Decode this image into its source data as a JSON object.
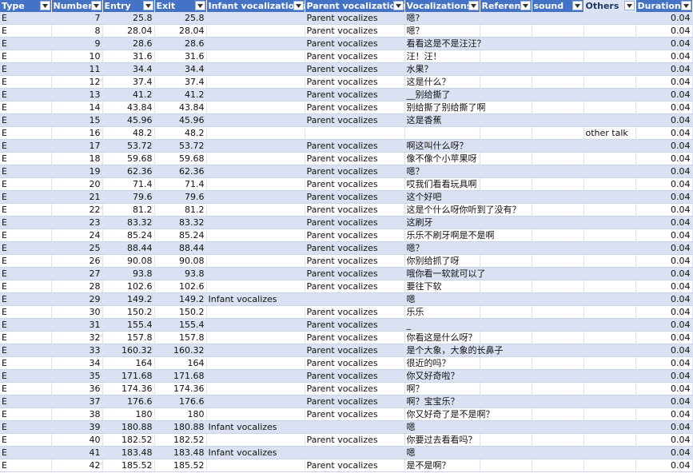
{
  "headers": [
    {
      "key": "type",
      "label": "Type"
    },
    {
      "key": "number",
      "label": "Number"
    },
    {
      "key": "entry",
      "label": "Entry"
    },
    {
      "key": "exit",
      "label": "Exit"
    },
    {
      "key": "infant",
      "label": "Infant vocalizations"
    },
    {
      "key": "parent",
      "label": "Parent vocalizations"
    },
    {
      "key": "vocalizations",
      "label": "Vocalizations"
    },
    {
      "key": "referent",
      "label": "Referent"
    },
    {
      "key": "sound",
      "label": "sound"
    },
    {
      "key": "others",
      "label": "Others"
    },
    {
      "key": "duration",
      "label": "Duration"
    }
  ],
  "rows": [
    {
      "type": "E",
      "number": "7",
      "entry": "25.8",
      "exit": "25.8",
      "infant": "",
      "parent": "Parent vocalizes",
      "vocalizations": "嗯?",
      "referent": "",
      "sound": "",
      "others": "",
      "duration": "0.04"
    },
    {
      "type": "E",
      "number": "8",
      "entry": "28.04",
      "exit": "28.04",
      "infant": "",
      "parent": "Parent vocalizes",
      "vocalizations": "嗯？",
      "referent": "",
      "sound": "",
      "others": "",
      "duration": "0.04"
    },
    {
      "type": "E",
      "number": "9",
      "entry": "28.6",
      "exit": "28.6",
      "infant": "",
      "parent": "Parent vocalizes",
      "vocalizations": "看看这是不是汪汪？",
      "referent": "",
      "sound": "",
      "others": "",
      "duration": "0.04"
    },
    {
      "type": "E",
      "number": "10",
      "entry": "31.6",
      "exit": "31.6",
      "infant": "",
      "parent": "Parent vocalizes",
      "vocalizations": "汪！汪！",
      "referent": "",
      "sound": "",
      "others": "",
      "duration": "0.04"
    },
    {
      "type": "E",
      "number": "11",
      "entry": "34.4",
      "exit": "34.4",
      "infant": "",
      "parent": "Parent vocalizes",
      "vocalizations": "水果？",
      "referent": "",
      "sound": "",
      "others": "",
      "duration": "0.04"
    },
    {
      "type": "E",
      "number": "12",
      "entry": "37.4",
      "exit": "37.4",
      "infant": "",
      "parent": "Parent vocalizes",
      "vocalizations": "这是什么？",
      "referent": "",
      "sound": "",
      "others": "",
      "duration": "0.04"
    },
    {
      "type": "E",
      "number": "13",
      "entry": "41.2",
      "exit": "41.2",
      "infant": "",
      "parent": "Parent vocalizes",
      "vocalizations": "__别给撕了",
      "referent": "",
      "sound": "",
      "others": "",
      "duration": "0.04"
    },
    {
      "type": "E",
      "number": "14",
      "entry": "43.84",
      "exit": "43.84",
      "infant": "",
      "parent": "Parent vocalizes",
      "vocalizations": "别给撕了别给撕了啊",
      "referent": "",
      "sound": "",
      "others": "",
      "duration": "0.04"
    },
    {
      "type": "E",
      "number": "15",
      "entry": "45.96",
      "exit": "45.96",
      "infant": "",
      "parent": "Parent vocalizes",
      "vocalizations": "这是香蕉",
      "referent": "",
      "sound": "",
      "others": "",
      "duration": "0.04"
    },
    {
      "type": "E",
      "number": "16",
      "entry": "48.2",
      "exit": "48.2",
      "infant": "",
      "parent": "",
      "vocalizations": "",
      "referent": "",
      "sound": "",
      "others": "other talk",
      "duration": "0.04"
    },
    {
      "type": "E",
      "number": "17",
      "entry": "53.72",
      "exit": "53.72",
      "infant": "",
      "parent": "Parent vocalizes",
      "vocalizations": "啊这叫什么呀？",
      "referent": "",
      "sound": "",
      "others": "",
      "duration": "0.04"
    },
    {
      "type": "E",
      "number": "18",
      "entry": "59.68",
      "exit": "59.68",
      "infant": "",
      "parent": "Parent vocalizes",
      "vocalizations": "像不像个小苹果呀",
      "referent": "",
      "sound": "",
      "others": "",
      "duration": "0.04"
    },
    {
      "type": "E",
      "number": "19",
      "entry": "62.36",
      "exit": "62.36",
      "infant": "",
      "parent": "Parent vocalizes",
      "vocalizations": "嗯？",
      "referent": "",
      "sound": "",
      "others": "",
      "duration": "0.04"
    },
    {
      "type": "E",
      "number": "20",
      "entry": "71.4",
      "exit": "71.4",
      "infant": "",
      "parent": "Parent vocalizes",
      "vocalizations": "哎我们看看玩具啊",
      "referent": "",
      "sound": "",
      "others": "",
      "duration": "0.04"
    },
    {
      "type": "E",
      "number": "21",
      "entry": "79.6",
      "exit": "79.6",
      "infant": "",
      "parent": "Parent vocalizes",
      "vocalizations": "这个好吧",
      "referent": "",
      "sound": "",
      "others": "",
      "duration": "0.04"
    },
    {
      "type": "E",
      "number": "22",
      "entry": "81.2",
      "exit": "81.2",
      "infant": "",
      "parent": "Parent vocalizes",
      "vocalizations": "这是个什么呀你听到了没有？",
      "referent": "",
      "sound": "",
      "others": "",
      "duration": "0.04"
    },
    {
      "type": "E",
      "number": "23",
      "entry": "83.32",
      "exit": "83.32",
      "infant": "",
      "parent": "Parent vocalizes",
      "vocalizations": "这刷牙",
      "referent": "",
      "sound": "",
      "others": "",
      "duration": "0.04"
    },
    {
      "type": "E",
      "number": "24",
      "entry": "85.24",
      "exit": "85.24",
      "infant": "",
      "parent": "Parent vocalizes",
      "vocalizations": "乐乐不刷牙啊是不是啊",
      "referent": "",
      "sound": "",
      "others": "",
      "duration": "0.04"
    },
    {
      "type": "E",
      "number": "25",
      "entry": "88.44",
      "exit": "88.44",
      "infant": "",
      "parent": "Parent vocalizes",
      "vocalizations": "嗯？",
      "referent": "",
      "sound": "",
      "others": "",
      "duration": "0.04"
    },
    {
      "type": "E",
      "number": "26",
      "entry": "90.08",
      "exit": "90.08",
      "infant": "",
      "parent": "Parent vocalizes",
      "vocalizations": "你别给抓了呀",
      "referent": "",
      "sound": "",
      "others": "",
      "duration": "0.04"
    },
    {
      "type": "E",
      "number": "27",
      "entry": "93.8",
      "exit": "93.8",
      "infant": "",
      "parent": "Parent vocalizes",
      "vocalizations": "哦你看一软就可以了",
      "referent": "",
      "sound": "",
      "others": "",
      "duration": "0.04"
    },
    {
      "type": "E",
      "number": "28",
      "entry": "102.6",
      "exit": "102.6",
      "infant": "",
      "parent": "Parent vocalizes",
      "vocalizations": "要往下软",
      "referent": "",
      "sound": "",
      "others": "",
      "duration": "0.04"
    },
    {
      "type": "E",
      "number": "29",
      "entry": "149.2",
      "exit": "149.2",
      "infant": "Infant vocalizes",
      "parent": "",
      "vocalizations": "嗯",
      "referent": "",
      "sound": "",
      "others": "",
      "duration": "0.04"
    },
    {
      "type": "E",
      "number": "30",
      "entry": "150.2",
      "exit": "150.2",
      "infant": "",
      "parent": "Parent vocalizes",
      "vocalizations": "乐乐",
      "referent": "",
      "sound": "",
      "others": "",
      "duration": "0.04"
    },
    {
      "type": "E",
      "number": "31",
      "entry": "155.4",
      "exit": "155.4",
      "infant": "",
      "parent": "Parent vocalizes",
      "vocalizations": "_",
      "referent": "",
      "sound": "",
      "others": "",
      "duration": "0.04"
    },
    {
      "type": "E",
      "number": "32",
      "entry": "157.8",
      "exit": "157.8",
      "infant": "",
      "parent": "Parent vocalizes",
      "vocalizations": "你看这是什么呀？",
      "referent": "",
      "sound": "",
      "others": "",
      "duration": "0.04"
    },
    {
      "type": "E",
      "number": "33",
      "entry": "160.32",
      "exit": "160.32",
      "infant": "",
      "parent": "Parent vocalizes",
      "vocalizations": "是个大象，大象的长鼻子",
      "referent": "",
      "sound": "",
      "others": "",
      "duration": "0.04"
    },
    {
      "type": "E",
      "number": "34",
      "entry": "164",
      "exit": "164",
      "infant": "",
      "parent": "Parent vocalizes",
      "vocalizations": "很近的吗？",
      "referent": "",
      "sound": "",
      "others": "",
      "duration": "0.04"
    },
    {
      "type": "E",
      "number": "35",
      "entry": "171.68",
      "exit": "171.68",
      "infant": "",
      "parent": "Parent vocalizes",
      "vocalizations": "你又好奇啦？",
      "referent": "",
      "sound": "",
      "others": "",
      "duration": "0.04"
    },
    {
      "type": "E",
      "number": "36",
      "entry": "174.36",
      "exit": "174.36",
      "infant": "",
      "parent": "Parent vocalizes",
      "vocalizations": "啊？",
      "referent": "",
      "sound": "",
      "others": "",
      "duration": "0.04"
    },
    {
      "type": "E",
      "number": "37",
      "entry": "176.6",
      "exit": "176.6",
      "infant": "",
      "parent": "Parent vocalizes",
      "vocalizations": "啊？宝宝乐？",
      "referent": "",
      "sound": "",
      "others": "",
      "duration": "0.04"
    },
    {
      "type": "E",
      "number": "38",
      "entry": "180",
      "exit": "180",
      "infant": "",
      "parent": "Parent vocalizes",
      "vocalizations": "你又好奇了是不是啊？",
      "referent": "",
      "sound": "",
      "others": "",
      "duration": "0.04"
    },
    {
      "type": "E",
      "number": "39",
      "entry": "180.88",
      "exit": "180.88",
      "infant": "Infant vocalizes",
      "parent": "",
      "vocalizations": "嗯",
      "referent": "",
      "sound": "",
      "others": "",
      "duration": "0.04"
    },
    {
      "type": "E",
      "number": "40",
      "entry": "182.52",
      "exit": "182.52",
      "infant": "",
      "parent": "Parent vocalizes",
      "vocalizations": "你要过去看看吗？",
      "referent": "",
      "sound": "",
      "others": "",
      "duration": "0.04"
    },
    {
      "type": "E",
      "number": "41",
      "entry": "183.48",
      "exit": "183.48",
      "infant": "Infant vocalizes",
      "parent": "",
      "vocalizations": "嗯",
      "referent": "",
      "sound": "",
      "others": "",
      "duration": "0.04"
    },
    {
      "type": "E",
      "number": "42",
      "entry": "185.52",
      "exit": "185.52",
      "infant": "",
      "parent": "Parent vocalizes",
      "vocalizations": "是不是啊？",
      "referent": "",
      "sound": "",
      "others": "",
      "duration": "0.04"
    }
  ],
  "icons": {
    "filter": "filter-dropdown-icon"
  },
  "colors": {
    "header": "#4472c4",
    "band": "#d9e1f2",
    "header_text": "#ffffff"
  }
}
